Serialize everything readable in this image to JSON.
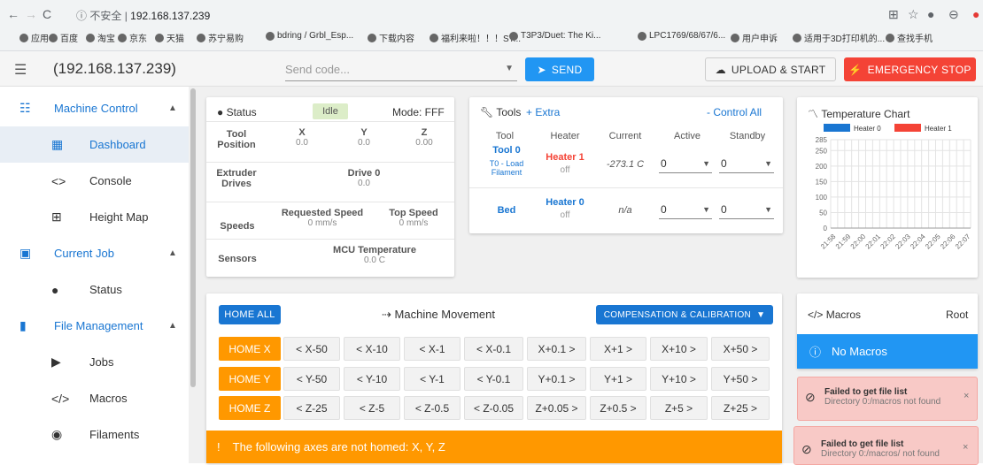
{
  "browser": {
    "address_secure": "不安全",
    "address_host": "192.168.137.239",
    "bookmarks": [
      "应用",
      "百度",
      "淘宝",
      "京东",
      "天猫",
      "苏宁易购",
      "bdring / Grbl_Esp...",
      "下载内容",
      "福利来啦！！！ST...",
      "T3P3/Duet: The Ki...",
      "LPC1769/68/67/6...",
      "用户申诉",
      "适用于3D打印机的...",
      "查找手机"
    ]
  },
  "header": {
    "host": "(192.168.137.239)",
    "send_placeholder": "Send code...",
    "send_label": "SEND",
    "upload_label": "UPLOAD & START",
    "estop_label": "EMERGENCY STOP"
  },
  "sidebar": {
    "machine_control": "Machine Control",
    "dashboard": "Dashboard",
    "console": "Console",
    "height_map": "Height Map",
    "current_job": "Current Job",
    "status": "Status",
    "file_management": "File Management",
    "jobs": "Jobs",
    "macros": "Macros",
    "filaments": "Filaments"
  },
  "status_card": {
    "title": "Status",
    "state": "Idle",
    "mode": "Mode: FFF",
    "tool_position_label": "Tool Position",
    "axes": [
      {
        "name": "X",
        "value": "0.0"
      },
      {
        "name": "Y",
        "value": "0.0"
      },
      {
        "name": "Z",
        "value": "0.00"
      }
    ],
    "extruder_label": "Extruder Drives",
    "drive_name": "Drive 0",
    "drive_value": "0.0",
    "speeds_label": "Speeds",
    "requested_speed_label": "Requested Speed",
    "requested_speed_value": "0 mm/s",
    "top_speed_label": "Top Speed",
    "top_speed_value": "0 mm/s",
    "sensors_label": "Sensors",
    "mcu_temp_label": "MCU Temperature",
    "mcu_temp_value": "0.0 C"
  },
  "tools_card": {
    "title": "Tools",
    "extra": "+ Extra",
    "control_all": "- Control All",
    "col_tool": "Tool",
    "col_heater": "Heater",
    "col_current": "Current",
    "col_active": "Active",
    "col_standby": "Standby",
    "tool0_name": "Tool 0",
    "tool0_sub": "T0 - Load Filament",
    "tool0_heater": "Heater 1",
    "tool0_heater_state": "off",
    "tool0_current": "-273.1 C",
    "tool0_active": "0",
    "tool0_standby": "0",
    "bed_name": "Bed",
    "bed_heater": "Heater 0",
    "bed_heater_state": "off",
    "bed_current": "n/a",
    "bed_active": "0",
    "bed_standby": "0"
  },
  "temp_chart": {
    "title": "Temperature Chart"
  },
  "chart_data": {
    "type": "line",
    "title": "Temperature Chart",
    "series": [
      {
        "name": "Heater 0",
        "color": "#1976d2",
        "values": []
      },
      {
        "name": "Heater 1",
        "color": "#f44336",
        "values": []
      }
    ],
    "yticks": [
      "0",
      "50",
      "100",
      "150",
      "200",
      "250",
      "285"
    ],
    "ylim": [
      0,
      285
    ],
    "xticks": [
      "21:58",
      "21:59",
      "22:00",
      "22:01",
      "22:02",
      "22:03",
      "22:04",
      "22:05",
      "22:06",
      "22:07"
    ],
    "grid": true,
    "legend": "top"
  },
  "movement": {
    "home_all": "HOME ALL",
    "title": "Machine Movement",
    "compensation": "COMPENSATION & CALIBRATION",
    "rows": [
      {
        "home": "HOME X",
        "buttons": [
          "< X-50",
          "< X-10",
          "< X-1",
          "< X-0.1",
          "X+0.1 >",
          "X+1 >",
          "X+10 >",
          "X+50 >"
        ]
      },
      {
        "home": "HOME Y",
        "buttons": [
          "< Y-50",
          "< Y-10",
          "< Y-1",
          "< Y-0.1",
          "Y+0.1 >",
          "Y+1 >",
          "Y+10 >",
          "Y+50 >"
        ]
      },
      {
        "home": "HOME Z",
        "buttons": [
          "< Z-25",
          "< Z-5",
          "< Z-0.5",
          "< Z-0.05",
          "Z+0.05 >",
          "Z+0.5 >",
          "Z+5 >",
          "Z+25 >"
        ]
      }
    ],
    "warning": "The following axes are not homed: X, Y, Z"
  },
  "macros": {
    "title": "Macros",
    "root": "Root",
    "empty": "No Macros"
  },
  "notifications": [
    {
      "title": "Failed to get file list",
      "text": "Directory 0:/macros not found"
    },
    {
      "title": "Failed to get file list",
      "text": "Directory 0:/macros/ not found"
    }
  ]
}
